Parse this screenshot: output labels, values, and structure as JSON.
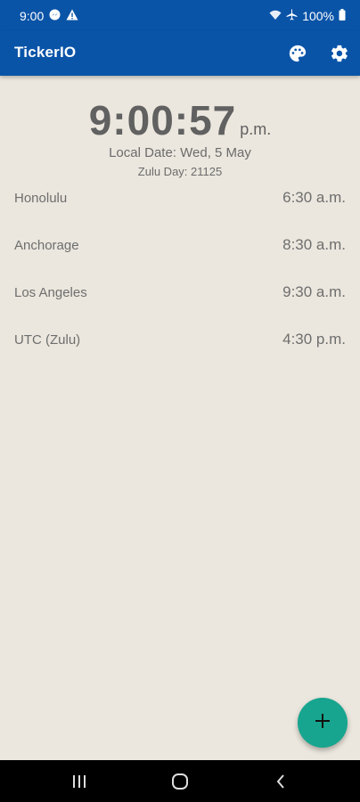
{
  "status_bar": {
    "time": "9:00",
    "battery": "100%",
    "icons": [
      "messenger-icon",
      "warning-icon",
      "wifi-icon",
      "airplane-icon",
      "battery-icon"
    ]
  },
  "app_bar": {
    "title": "TickerIO",
    "actions": [
      "palette-icon",
      "settings-icon"
    ]
  },
  "clock": {
    "time": "9:00:57",
    "ampm": "p.m.",
    "local_date": "Local Date: Wed, 5 May",
    "zulu_day": "Zulu Day: 21125"
  },
  "zones": [
    {
      "city": "Honolulu",
      "time": "6:30 a.m."
    },
    {
      "city": "Anchorage",
      "time": "8:30 a.m."
    },
    {
      "city": "Los Angeles",
      "time": "9:30 a.m."
    },
    {
      "city": "UTC (Zulu)",
      "time": "4:30 p.m."
    }
  ],
  "fab": {
    "icon": "add-icon"
  },
  "nav_bar": {
    "buttons": [
      "recents-icon",
      "home-icon",
      "back-icon"
    ]
  },
  "colors": {
    "primary": "#0a54a8",
    "background": "#ebe7de",
    "fab": "#17a58f"
  }
}
